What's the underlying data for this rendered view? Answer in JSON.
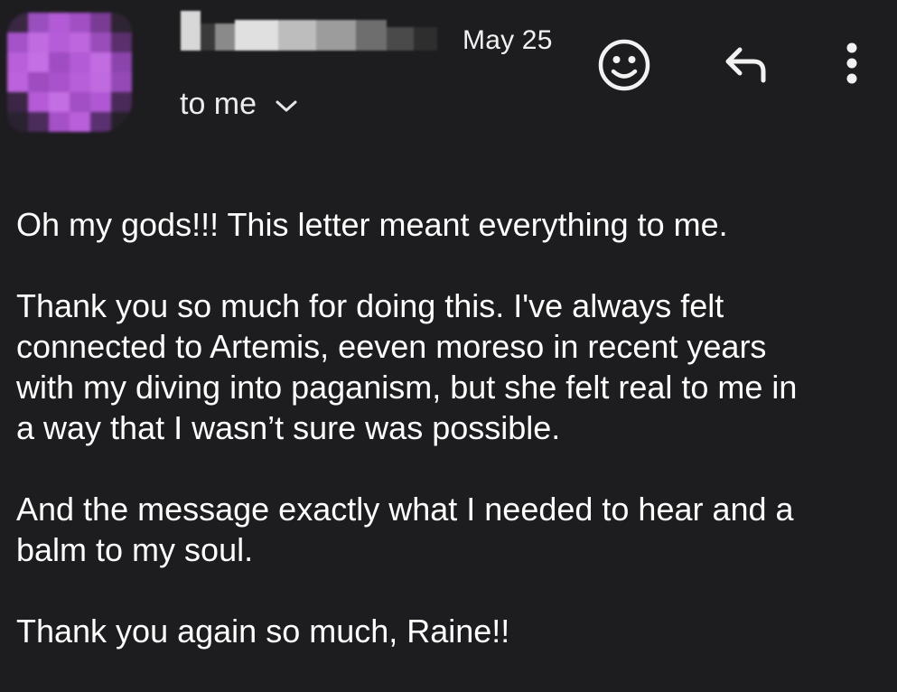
{
  "email": {
    "header": {
      "avatar_icon": "avatar-redacted",
      "sender_redacted": true,
      "date": "May 25",
      "recipient_label": "to me",
      "recipient_toggle_icon": "chevron-down-icon",
      "actions": {
        "emoji_icon": "smiley-icon",
        "reply_icon": "reply-icon",
        "more_icon": "more-vertical-icon"
      }
    },
    "body": {
      "paragraphs": [
        {
          "lines": [
            "Oh my gods!!! This letter meant everything to me."
          ]
        },
        {
          "lines": [
            "Thank you so much for doing this. I've always felt",
            "connected to Artemis, eeven moreso in recent years",
            "with my diving into paganism, but she felt real to me in",
            "a way that I wasn’t sure was possible."
          ]
        },
        {
          "lines": [
            "And the message exactly what I needed to hear and a",
            "balm to my soul."
          ]
        },
        {
          "lines": [
            "Thank you again so much, Raine!!"
          ]
        }
      ]
    }
  },
  "colors": {
    "background": "#1d1c1f",
    "text": "#ffffff",
    "avatar_accent": "#b35ad6"
  }
}
